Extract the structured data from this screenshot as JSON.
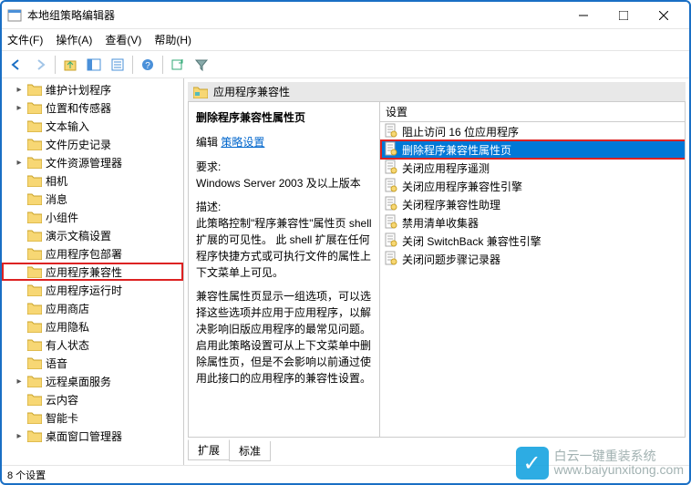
{
  "title": "本地组策略编辑器",
  "menus": {
    "file": "文件(F)",
    "action": "操作(A)",
    "view": "查看(V)",
    "help": "帮助(H)"
  },
  "tree": [
    {
      "label": "维护计划程序",
      "exp": "▸"
    },
    {
      "label": "位置和传感器",
      "exp": "▸"
    },
    {
      "label": "文本输入",
      "exp": ""
    },
    {
      "label": "文件历史记录",
      "exp": ""
    },
    {
      "label": "文件资源管理器",
      "exp": "▸"
    },
    {
      "label": "相机",
      "exp": ""
    },
    {
      "label": "消息",
      "exp": ""
    },
    {
      "label": "小组件",
      "exp": ""
    },
    {
      "label": "演示文稿设置",
      "exp": ""
    },
    {
      "label": "应用程序包部署",
      "exp": ""
    },
    {
      "label": "应用程序兼容性",
      "exp": "",
      "sel": true
    },
    {
      "label": "应用程序运行时",
      "exp": ""
    },
    {
      "label": "应用商店",
      "exp": ""
    },
    {
      "label": "应用隐私",
      "exp": ""
    },
    {
      "label": "有人状态",
      "exp": ""
    },
    {
      "label": "语音",
      "exp": ""
    },
    {
      "label": "远程桌面服务",
      "exp": "▸"
    },
    {
      "label": "云内容",
      "exp": ""
    },
    {
      "label": "智能卡",
      "exp": ""
    },
    {
      "label": "桌面窗口管理器",
      "exp": "▸"
    }
  ],
  "header": "应用程序兼容性",
  "desc": {
    "title": "删除程序兼容性属性页",
    "edit_label": "编辑",
    "edit_link": "策略设置",
    "req_label": "要求:",
    "req_text": "Windows Server 2003 及以上版本",
    "d_label": "描述:",
    "d_text": "此策略控制\"程序兼容性\"属性页 shell 扩展的可见性。 此 shell 扩展在任何程序快捷方式或可执行文件的属性上下文菜单上可见。",
    "d_text2": "兼容性属性页显示一组选项，可以选择这些选项并应用于应用程序，以解决影响旧版应用程序的最常见问题。启用此策略设置可从上下文菜单中删除属性页，但是不会影响以前通过使用此接口的应用程序的兼容性设置。"
  },
  "list_header": "设置",
  "settings": [
    {
      "label": "阻止访问 16 位应用程序"
    },
    {
      "label": "删除程序兼容性属性页",
      "sel": true
    },
    {
      "label": "关闭应用程序遥测"
    },
    {
      "label": "关闭应用程序兼容性引擎"
    },
    {
      "label": "关闭程序兼容性助理"
    },
    {
      "label": "禁用清单收集器"
    },
    {
      "label": "关闭 SwitchBack 兼容性引擎"
    },
    {
      "label": "关闭问题步骤记录器"
    }
  ],
  "tabs": {
    "extended": "扩展",
    "standard": "标准"
  },
  "status": "8 个设置",
  "watermark": {
    "line1": "白云一键重装系统",
    "line2": "www.baiyunxitong.com"
  }
}
